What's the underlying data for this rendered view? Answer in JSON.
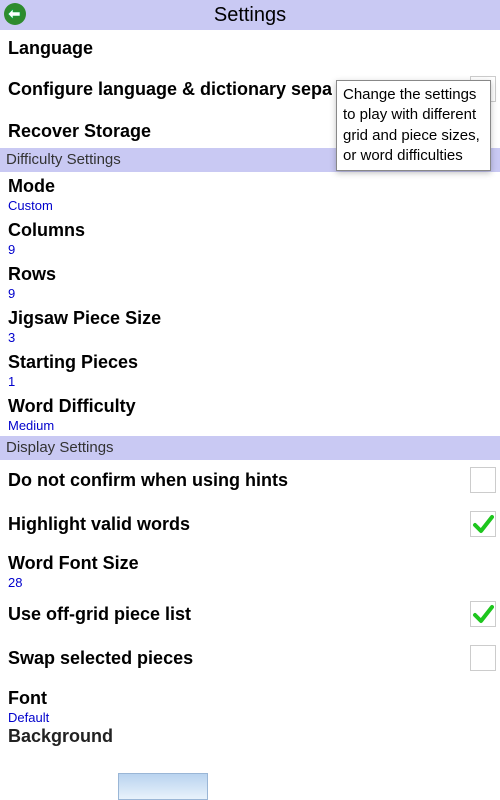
{
  "header": {
    "title": "Settings"
  },
  "tooltip": {
    "text": "Change the settings to play with different grid and piece sizes, or word difficulties"
  },
  "general": {
    "language": {
      "label": "Language"
    },
    "configure": {
      "label": "Configure language & dictionary sepa"
    },
    "recover": {
      "label": "Recover Storage"
    }
  },
  "sections": {
    "difficulty": {
      "title": "Difficulty Settings"
    },
    "display": {
      "title": "Display Settings"
    }
  },
  "difficulty": {
    "mode": {
      "label": "Mode",
      "value": "Custom"
    },
    "columns": {
      "label": "Columns",
      "value": "9"
    },
    "rows": {
      "label": "Rows",
      "value": "9"
    },
    "piece_size": {
      "label": "Jigsaw Piece Size",
      "value": "3"
    },
    "starting_pieces": {
      "label": "Starting Pieces",
      "value": "1"
    },
    "word_difficulty": {
      "label": "Word Difficulty",
      "value": "Medium"
    }
  },
  "display": {
    "no_confirm_hints": {
      "label": "Do not confirm when using hints",
      "checked": false
    },
    "highlight_valid": {
      "label": "Highlight valid words",
      "checked": true
    },
    "word_font_size": {
      "label": "Word Font Size",
      "value": "28"
    },
    "offgrid_list": {
      "label": "Use off-grid piece list",
      "checked": true
    },
    "swap_selected": {
      "label": "Swap selected pieces",
      "checked": false
    },
    "font": {
      "label": "Font",
      "value": "Default"
    },
    "background": {
      "label": "Background"
    }
  }
}
